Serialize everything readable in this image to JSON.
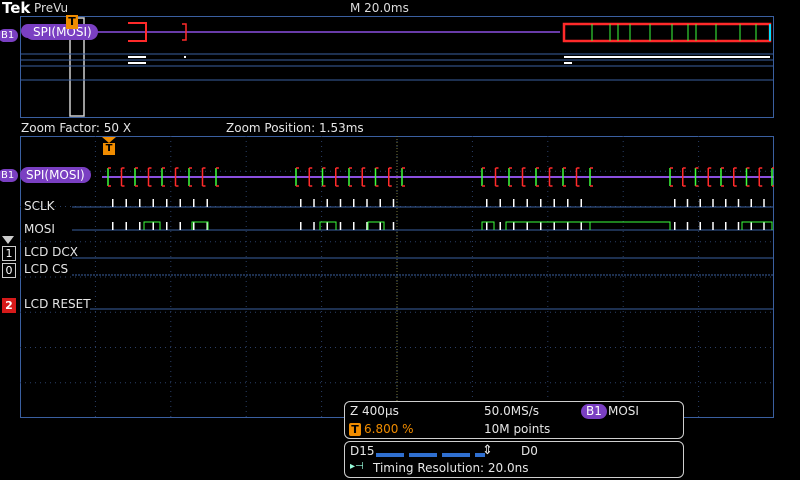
{
  "topbar": {
    "brand": "Tek",
    "mode": "PreVu",
    "horizontal_scale": "M 20.0ms"
  },
  "zoom_info": {
    "factor": "Zoom Factor: 50 X",
    "position": "Zoom Position: 1.53ms"
  },
  "bus": {
    "badge": "B1",
    "label": "SPI(MOSI)"
  },
  "trigger_marker": "T",
  "channels": {
    "sclk": "SCLK",
    "mosi": "MOSI",
    "lcd_dcx": "LCD DCX",
    "lcd_cs": "LCD CS",
    "lcd_reset": "LCD RESET",
    "mark_1": "1",
    "mark_0": "0",
    "mark_2": "2"
  },
  "readout": {
    "zoom_scale": "Z 400µs",
    "sample_rate": "50.0MS/s",
    "trigger_source_badge": "B1",
    "trigger_source": "MOSI",
    "trigger_position_badge": "T",
    "trigger_position": "6.800 %",
    "record_length": "10M points"
  },
  "digital_panel": {
    "high_channel": "D15",
    "low_channel": "D0",
    "timing_resolution": "Timing Resolution: 20.0ns"
  },
  "colors": {
    "bus_purple": "#7a3fc2",
    "grid_blue": "#3a5fa0",
    "trigger_orange": "#f08c00",
    "edge_red": "#ff2a2a",
    "edge_green": "#3cff3c",
    "lcd_reset_red": "#d61a1a"
  }
}
